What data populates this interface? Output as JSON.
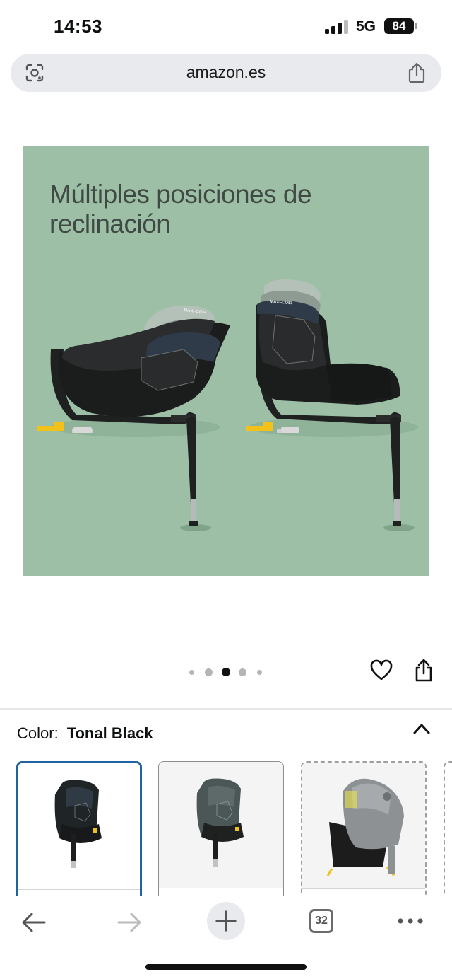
{
  "status_bar": {
    "time": "14:53",
    "network": "5G",
    "battery": "84"
  },
  "browser": {
    "url": "amazon.es"
  },
  "product_image": {
    "caption_line1": "Múltiples posiciones de",
    "caption_line2": "reclinación",
    "background_color": "#9dbfa6",
    "brand_mark": "MAXI-COSI"
  },
  "carousel": {
    "total": 5,
    "active_index": 2
  },
  "color_selector": {
    "label": "Color:",
    "selected_value": "Tonal Black",
    "swatches": [
      {
        "name": "swatch-tonal-black",
        "selected": true
      },
      {
        "name": "swatch-tonal-graphite",
        "selected": false
      },
      {
        "name": "swatch-grey",
        "selected": false,
        "unavailable": true
      }
    ]
  },
  "toolbar": {
    "tab_count": "32"
  },
  "colors": {
    "accent": "#2162a1",
    "image_bg": "#9dbfa6",
    "isofix_yellow": "#f2c21b"
  },
  "icons": [
    "google-lens-icon",
    "share-icon",
    "heart-icon",
    "chevron-up-icon",
    "back-arrow-icon",
    "forward-arrow-icon",
    "plus-icon",
    "tabs-icon",
    "more-icon"
  ]
}
